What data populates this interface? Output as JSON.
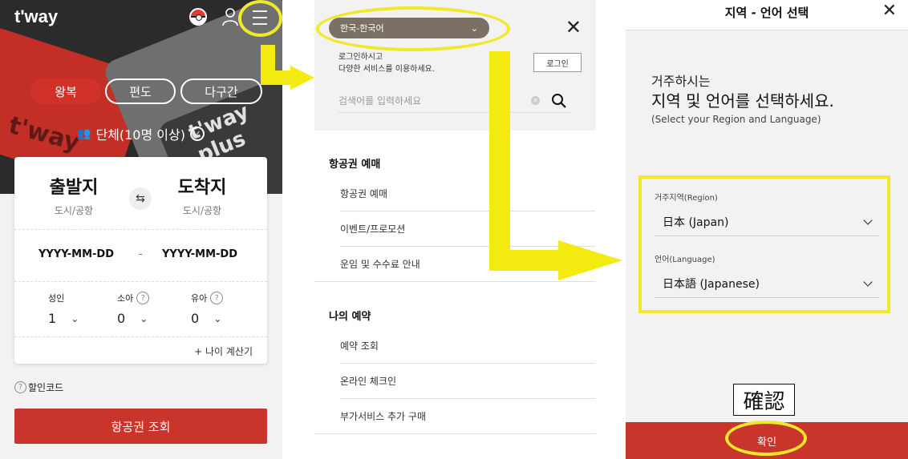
{
  "home": {
    "logo": "t'way",
    "deco_text_1": "t'way",
    "deco_text_2": "t'way plus",
    "trip_tabs": [
      "왕복",
      "편도",
      "다구간"
    ],
    "group_label": "단체(10명 이상)",
    "origin_title": "출발지",
    "origin_sub": "도시/공항",
    "dest_title": "도착지",
    "dest_sub": "도시/공항",
    "date_from": "YYYY-MM-DD",
    "date_sep": "-",
    "date_to": "YYYY-MM-DD",
    "passengers": [
      {
        "label": "성인",
        "value": "1"
      },
      {
        "label": "소아",
        "value": "0"
      },
      {
        "label": "유아",
        "value": "0"
      }
    ],
    "age_calc": "+ 나이 계산기",
    "promo_label": "할인코드",
    "search_button": "항공권 조회",
    "accent": "#c9352b"
  },
  "menu": {
    "language": "한국-한국어",
    "login_msg_1": "로그인하시고",
    "login_msg_2": "다양한 서비스를 이용하세요.",
    "login_button": "로그인",
    "search_placeholder": "검색어를 입력하세요",
    "sections": [
      {
        "title": "항공권 예매",
        "items": [
          "항공권 예매",
          "이벤트/프로모션",
          "운임 및 수수료 안내"
        ]
      },
      {
        "title": "나의 예약",
        "items": [
          "예약 조회",
          "온라인 체크인",
          "부가서비스 추가 구매"
        ]
      }
    ]
  },
  "region": {
    "title": "지역 - 언어 선택",
    "intro_1": "거주하시는",
    "intro_2": "지역 및 언어를 선택하세요.",
    "intro_3": "(Select your Region and Language)",
    "region_label": "거주지역(Region)",
    "region_value": "日本 (Japan)",
    "language_label": "언어(Language)",
    "language_value": "日本語 (Japanese)",
    "annotation": "確認",
    "confirm_button": "확인"
  },
  "highlight_color": "#f0e82a"
}
